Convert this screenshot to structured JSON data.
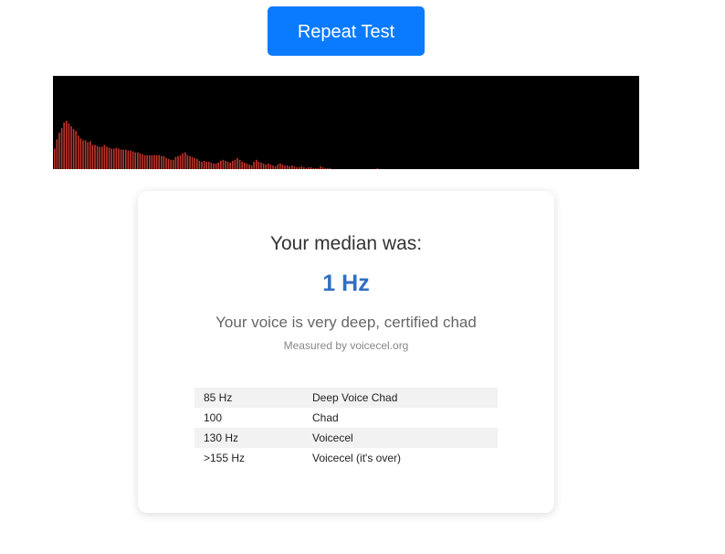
{
  "repeat_button": {
    "label": "Repeat Test"
  },
  "spectrum": {
    "bar_color": "#c0352b",
    "background": "#000000",
    "levels": [
      0.22,
      0.32,
      0.39,
      0.44,
      0.5,
      0.52,
      0.49,
      0.46,
      0.43,
      0.41,
      0.36,
      0.33,
      0.31,
      0.31,
      0.29,
      0.3,
      0.26,
      0.26,
      0.25,
      0.24,
      0.24,
      0.26,
      0.24,
      0.23,
      0.22,
      0.22,
      0.23,
      0.22,
      0.21,
      0.21,
      0.21,
      0.2,
      0.2,
      0.19,
      0.18,
      0.18,
      0.17,
      0.16,
      0.15,
      0.15,
      0.15,
      0.15,
      0.15,
      0.15,
      0.15,
      0.14,
      0.14,
      0.12,
      0.11,
      0.1,
      0.1,
      0.13,
      0.14,
      0.15,
      0.17,
      0.18,
      0.15,
      0.14,
      0.13,
      0.12,
      0.11,
      0.09,
      0.08,
      0.09,
      0.08,
      0.08,
      0.07,
      0.06,
      0.06,
      0.07,
      0.09,
      0.1,
      0.09,
      0.08,
      0.07,
      0.09,
      0.1,
      0.12,
      0.1,
      0.08,
      0.07,
      0.06,
      0.05,
      0.04,
      0.08,
      0.1,
      0.08,
      0.07,
      0.06,
      0.05,
      0.06,
      0.05,
      0.04,
      0.03,
      0.05,
      0.06,
      0.05,
      0.04,
      0.04,
      0.03,
      0.04,
      0.03,
      0.02,
      0.02,
      0.03,
      0.02,
      0.01,
      0.02,
      0.02,
      0.01,
      0.01,
      0.01,
      0.03,
      0.02,
      0.01,
      0.01,
      0.01,
      0.0,
      0.0,
      0.0,
      0.0,
      0.0,
      0.0,
      0.0,
      0.0,
      0.0,
      0.0,
      0.0,
      0.0,
      0.0,
      0.0,
      0.0,
      0.0,
      0.0,
      0.0,
      0.0,
      0.01,
      0.0,
      0.0,
      0.0,
      0.0
    ]
  },
  "result": {
    "median_label": "Your median was:",
    "median_value": "1 Hz",
    "verdict": "Your voice is very deep, certified chad",
    "source": "Measured by voicecel.org"
  },
  "reference_table": [
    {
      "frequency": "85 Hz",
      "category": "Deep Voice Chad"
    },
    {
      "frequency": "100",
      "category": "Chad"
    },
    {
      "frequency": "130 Hz",
      "category": "Voicecel"
    },
    {
      "frequency": ">155 Hz",
      "category": "Voicecel (it's over)"
    }
  ]
}
